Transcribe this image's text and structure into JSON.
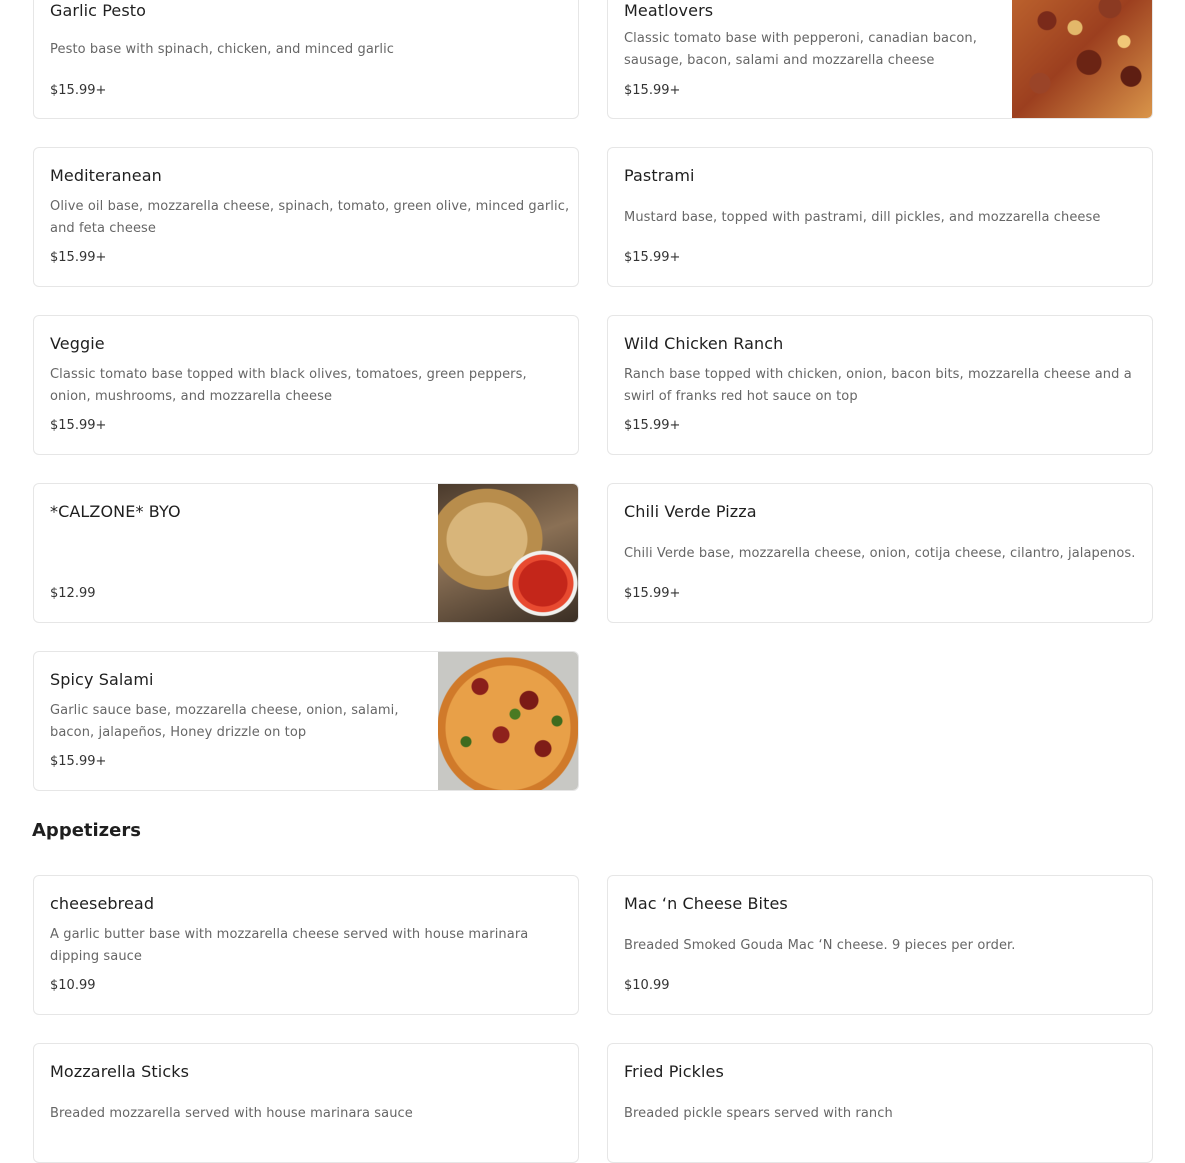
{
  "pizzas": [
    {
      "name": "Garlic Pesto",
      "desc": "Pesto base with spinach, chicken, and minced garlic",
      "price": "$15.99+"
    },
    {
      "name": "Meatlovers",
      "desc": "Classic tomato base with pepperoni, canadian bacon, sausage, bacon, salami and mozzarella cheese",
      "price": "$15.99+",
      "image": "meatlovers-photo"
    },
    {
      "name": "Mediteranean",
      "desc": "Olive oil base, mozzarella cheese, spinach, tomato, green olive, minced garlic, and feta cheese",
      "price": "$15.99+"
    },
    {
      "name": "Pastrami",
      "desc": "Mustard base, topped with pastrami, dill pickles, and mozzarella cheese",
      "price": "$15.99+"
    },
    {
      "name": "Veggie",
      "desc": "Classic tomato base topped with black olives, tomatoes, green peppers, onion, mushrooms, and mozzarella cheese",
      "price": "$15.99+"
    },
    {
      "name": "Wild Chicken Ranch",
      "desc": "Ranch base topped with chicken, onion, bacon bits, mozzarella cheese and a swirl of franks red hot sauce on top",
      "price": "$15.99+"
    },
    {
      "name": "*CALZONE* BYO",
      "desc": "",
      "price": "$12.99",
      "image": "calzone-photo"
    },
    {
      "name": "Chili Verde Pizza",
      "desc": "Chili Verde base, mozzarella cheese, onion, cotija cheese, cilantro, jalapenos.",
      "price": "$15.99+"
    },
    {
      "name": "Spicy Salami",
      "desc": "Garlic sauce base, mozzarella cheese, onion, salami, bacon, jalapeños, Honey drizzle on top",
      "price": "$15.99+",
      "image": "spicy-salami-photo"
    }
  ],
  "appetizers_title": "Appetizers",
  "appetizers": [
    {
      "name": "cheesebread",
      "desc": "A garlic butter base with mozzarella cheese served with house marinara dipping sauce",
      "price": "$10.99"
    },
    {
      "name": "Mac ‘n Cheese Bites",
      "desc": "Breaded Smoked Gouda Mac ‘N cheese. 9 pieces per order.",
      "price": "$10.99"
    },
    {
      "name": "Mozzarella Sticks",
      "desc": "Breaded mozzarella served with house marinara sauce",
      "price": ""
    },
    {
      "name": "Fried Pickles",
      "desc": "Breaded pickle spears served with ranch",
      "price": ""
    }
  ]
}
